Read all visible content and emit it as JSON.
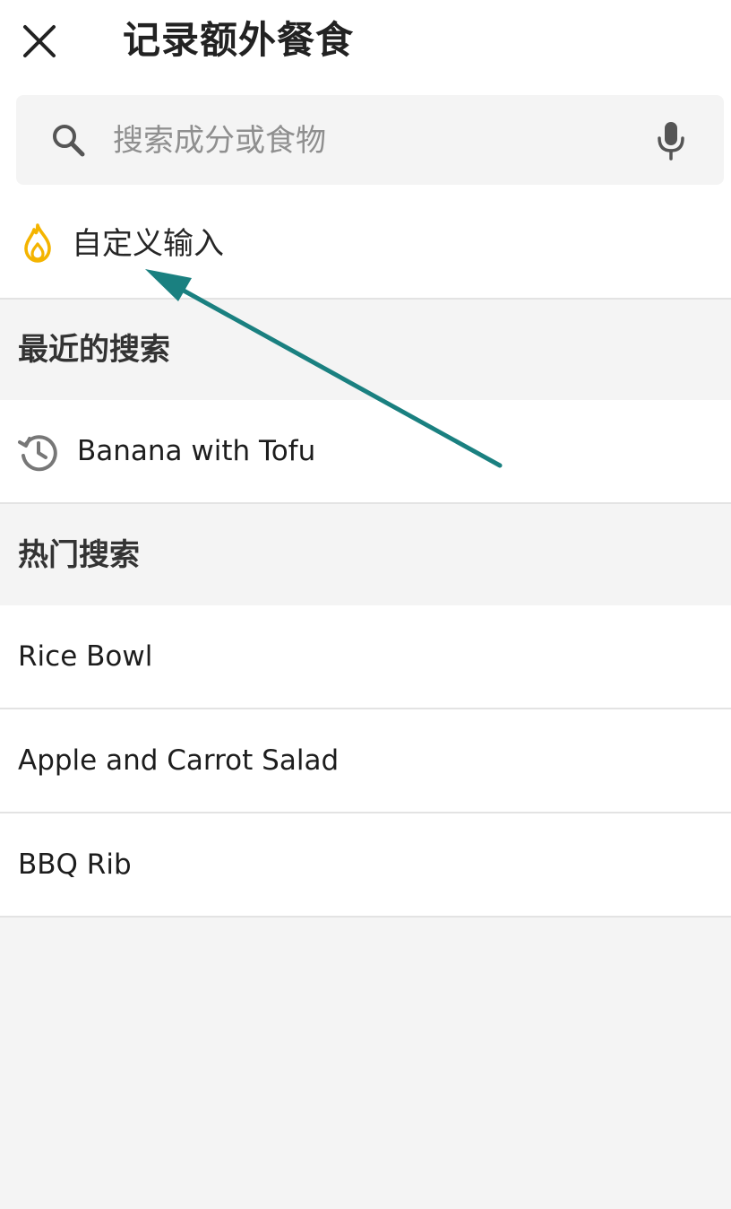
{
  "header": {
    "title": "记录额外餐食",
    "close_icon": "close-icon"
  },
  "search": {
    "placeholder": "搜索成分或食物",
    "value": "",
    "search_icon": "search-icon",
    "mic_icon": "microphone-icon"
  },
  "custom_entry": {
    "label": "自定义输入",
    "icon": "flame-icon",
    "icon_color": "#f4b400"
  },
  "recent": {
    "title": "最近的搜索",
    "items": [
      {
        "label": "Banana with Tofu",
        "icon": "history-icon"
      }
    ]
  },
  "popular": {
    "title": "热门搜索",
    "items": [
      {
        "label": "Rice Bowl"
      },
      {
        "label": "Apple and Carrot Salad"
      },
      {
        "label": "BBQ Rib"
      }
    ]
  },
  "annotation": {
    "arrow_color": "#1a8080",
    "icon": "annotation-arrow"
  }
}
